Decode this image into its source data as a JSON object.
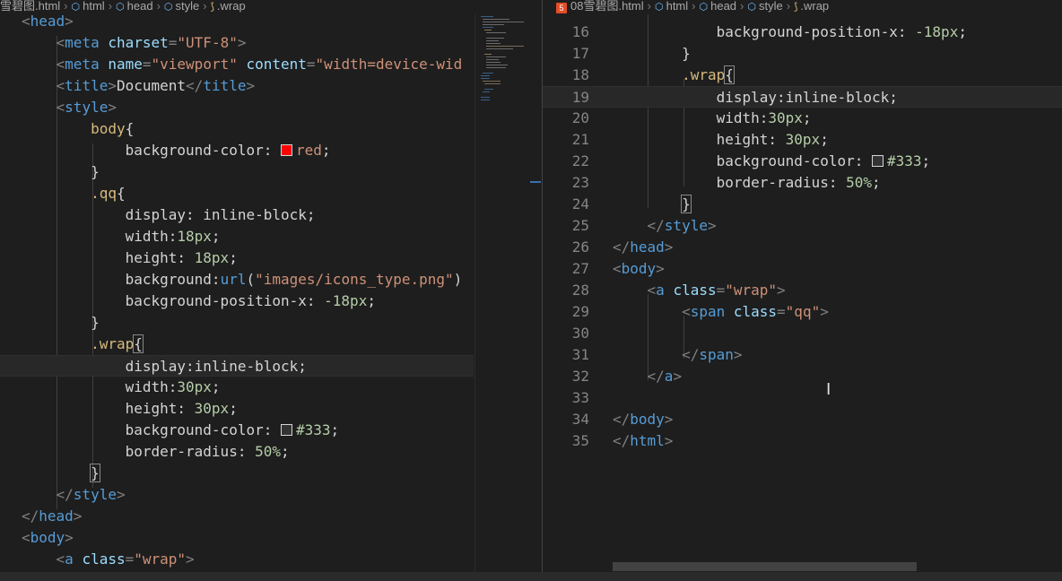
{
  "left_breadcrumb": {
    "file": "雪碧图.html",
    "path": [
      "html",
      "head",
      "style",
      ".wrap"
    ]
  },
  "right_breadcrumb": {
    "file": "08雪碧图.html",
    "path": [
      "html",
      "head",
      "style",
      ".wrap"
    ]
  },
  "left_editor": {
    "lines": [
      [
        [
          "t-punc",
          "<"
        ],
        [
          "t-tag",
          "head"
        ],
        [
          "t-punc",
          ">"
        ]
      ],
      [
        [
          "",
          "    "
        ],
        [
          "t-punc",
          "<"
        ],
        [
          "t-tag",
          "meta"
        ],
        [
          "t-attr",
          " charset"
        ],
        [
          "t-punc",
          "="
        ],
        [
          "t-str",
          "\"UTF-8\""
        ],
        [
          "t-punc",
          ">"
        ]
      ],
      [
        [
          "",
          "    "
        ],
        [
          "t-punc",
          "<"
        ],
        [
          "t-tag",
          "meta"
        ],
        [
          "t-attr",
          " name"
        ],
        [
          "t-punc",
          "="
        ],
        [
          "t-str",
          "\"viewport\""
        ],
        [
          "t-attr",
          " content"
        ],
        [
          "t-punc",
          "="
        ],
        [
          "t-str",
          "\"width=device-wid"
        ]
      ],
      [
        [
          "",
          "    "
        ],
        [
          "t-punc",
          "<"
        ],
        [
          "t-tag",
          "title"
        ],
        [
          "t-punc",
          ">"
        ],
        [
          "t-prop",
          "Document"
        ],
        [
          "t-punc",
          "</"
        ],
        [
          "t-tag",
          "title"
        ],
        [
          "t-punc",
          ">"
        ]
      ],
      [
        [
          "",
          "    "
        ],
        [
          "t-punc",
          "<"
        ],
        [
          "t-tag",
          "style"
        ],
        [
          "t-punc",
          ">"
        ]
      ],
      [
        [
          "",
          "        "
        ],
        [
          "t-sel",
          "body"
        ],
        [
          "t-prop",
          "{"
        ]
      ],
      [
        [
          "",
          "            "
        ],
        [
          "t-prop",
          "background-color: "
        ],
        [
          "swatch-red",
          ""
        ],
        [
          "t-str",
          "red"
        ],
        [
          "t-prop",
          ";"
        ]
      ],
      [
        [
          "",
          "        "
        ],
        [
          "t-prop",
          "}"
        ]
      ],
      [
        [
          "",
          "        "
        ],
        [
          "t-sel",
          ".qq"
        ],
        [
          "t-prop",
          "{"
        ]
      ],
      [
        [
          "",
          "            "
        ],
        [
          "t-prop",
          "display: inline-block;"
        ]
      ],
      [
        [
          "",
          "            "
        ],
        [
          "t-prop",
          "width:"
        ],
        [
          "t-num",
          "18px"
        ],
        [
          "t-prop",
          ";"
        ]
      ],
      [
        [
          "",
          "            "
        ],
        [
          "t-prop",
          "height: "
        ],
        [
          "t-num",
          "18px"
        ],
        [
          "t-prop",
          ";"
        ]
      ],
      [
        [
          "",
          "            "
        ],
        [
          "t-prop",
          "background:"
        ],
        [
          "t-url",
          "url"
        ],
        [
          "t-prop",
          "("
        ],
        [
          "t-str",
          "\"images/icons_type.png\""
        ],
        [
          "t-prop",
          ")"
        ]
      ],
      [
        [
          "",
          "            "
        ],
        [
          "t-prop",
          "background-position-x: "
        ],
        [
          "t-num",
          "-18px"
        ],
        [
          "t-prop",
          ";"
        ]
      ],
      [
        [
          "",
          "        "
        ],
        [
          "t-prop",
          "}"
        ]
      ],
      [
        [
          "",
          "        "
        ],
        [
          "t-sel",
          ".wrap"
        ],
        [
          "bracket",
          "{"
        ]
      ],
      [
        [
          "",
          "            "
        ],
        [
          "t-prop",
          "display:inline-block;"
        ]
      ],
      [
        [
          "",
          "            "
        ],
        [
          "t-prop",
          "width:"
        ],
        [
          "t-num",
          "30px"
        ],
        [
          "t-prop",
          ";"
        ]
      ],
      [
        [
          "",
          "            "
        ],
        [
          "t-prop",
          "height: "
        ],
        [
          "t-num",
          "30px"
        ],
        [
          "t-prop",
          ";"
        ]
      ],
      [
        [
          "",
          "            "
        ],
        [
          "t-prop",
          "background-color: "
        ],
        [
          "swatch-dark",
          ""
        ],
        [
          "t-num",
          "#333"
        ],
        [
          "t-prop",
          ";"
        ]
      ],
      [
        [
          "",
          "            "
        ],
        [
          "t-prop",
          "border-radius: "
        ],
        [
          "t-num",
          "50%"
        ],
        [
          "t-prop",
          ";"
        ]
      ],
      [
        [
          "",
          "        "
        ],
        [
          "bracket",
          "}"
        ]
      ],
      [
        [
          "",
          "    "
        ],
        [
          "t-punc",
          "</"
        ],
        [
          "t-tag",
          "style"
        ],
        [
          "t-punc",
          ">"
        ]
      ],
      [
        [
          "t-punc",
          "</"
        ],
        [
          "t-tag",
          "head"
        ],
        [
          "t-punc",
          ">"
        ]
      ],
      [
        [
          "t-punc",
          "<"
        ],
        [
          "t-tag",
          "body"
        ],
        [
          "t-punc",
          ">"
        ]
      ],
      [
        [
          "",
          "    "
        ],
        [
          "t-punc",
          "<"
        ],
        [
          "t-tag",
          "a"
        ],
        [
          "t-attr",
          " class"
        ],
        [
          "t-punc",
          "="
        ],
        [
          "t-str",
          "\"wrap\""
        ],
        [
          "t-punc",
          ">"
        ]
      ]
    ]
  },
  "right_editor": {
    "first_line_number": 16,
    "lines": [
      [
        [
          "",
          "            "
        ],
        [
          "t-prop",
          "background-position-x: "
        ],
        [
          "t-num",
          "-18px"
        ],
        [
          "t-prop",
          ";"
        ]
      ],
      [
        [
          "",
          "        "
        ],
        [
          "t-prop",
          "}"
        ]
      ],
      [
        [
          "",
          "        "
        ],
        [
          "t-sel",
          ".wrap"
        ],
        [
          "bracket",
          "{"
        ]
      ],
      [
        [
          "",
          "            "
        ],
        [
          "t-prop",
          "display:inline-block;"
        ]
      ],
      [
        [
          "",
          "            "
        ],
        [
          "t-prop",
          "width:"
        ],
        [
          "t-num",
          "30px"
        ],
        [
          "t-prop",
          ";"
        ]
      ],
      [
        [
          "",
          "            "
        ],
        [
          "t-prop",
          "height: "
        ],
        [
          "t-num",
          "30px"
        ],
        [
          "t-prop",
          ";"
        ]
      ],
      [
        [
          "",
          "            "
        ],
        [
          "t-prop",
          "background-color: "
        ],
        [
          "swatch-dark",
          ""
        ],
        [
          "t-num",
          "#333"
        ],
        [
          "t-prop",
          ";"
        ]
      ],
      [
        [
          "",
          "            "
        ],
        [
          "t-prop",
          "border-radius: "
        ],
        [
          "t-num",
          "50%"
        ],
        [
          "t-prop",
          ";"
        ]
      ],
      [
        [
          "",
          "        "
        ],
        [
          "bracket",
          "}"
        ]
      ],
      [
        [
          "",
          "    "
        ],
        [
          "t-punc",
          "</"
        ],
        [
          "t-tag",
          "style"
        ],
        [
          "t-punc",
          ">"
        ]
      ],
      [
        [
          "t-punc",
          "</"
        ],
        [
          "t-tag",
          "head"
        ],
        [
          "t-punc",
          ">"
        ]
      ],
      [
        [
          "t-punc",
          "<"
        ],
        [
          "t-tag",
          "body"
        ],
        [
          "t-punc",
          ">"
        ]
      ],
      [
        [
          "",
          "    "
        ],
        [
          "t-punc",
          "<"
        ],
        [
          "t-tag",
          "a"
        ],
        [
          "t-attr",
          " class"
        ],
        [
          "t-punc",
          "="
        ],
        [
          "t-str",
          "\"wrap\""
        ],
        [
          "t-punc",
          ">"
        ]
      ],
      [
        [
          "",
          "        "
        ],
        [
          "t-punc",
          "<"
        ],
        [
          "t-tag",
          "span"
        ],
        [
          "t-attr",
          " class"
        ],
        [
          "t-punc",
          "="
        ],
        [
          "t-str",
          "\"qq\""
        ],
        [
          "t-punc",
          ">"
        ]
      ],
      [],
      [
        [
          "",
          "        "
        ],
        [
          "t-punc",
          "</"
        ],
        [
          "t-tag",
          "span"
        ],
        [
          "t-punc",
          ">"
        ]
      ],
      [
        [
          "",
          "    "
        ],
        [
          "t-punc",
          "</"
        ],
        [
          "t-tag",
          "a"
        ],
        [
          "t-punc",
          ">"
        ]
      ],
      [],
      [
        [
          "t-punc",
          "</"
        ],
        [
          "t-tag",
          "body"
        ],
        [
          "t-punc",
          ">"
        ]
      ],
      [
        [
          "t-punc",
          "</"
        ],
        [
          "t-tag",
          "html"
        ],
        [
          "t-punc",
          ">"
        ]
      ]
    ]
  },
  "colors": {
    "editor_bg": "#1e1e1e",
    "tag": "#569cd6",
    "attribute": "#9cdcfe",
    "string": "#ce9178",
    "selector": "#d7ba7d",
    "number": "#b5cea8",
    "swatch_red": "#ff0000",
    "swatch_dark": "#333333"
  },
  "icons": {
    "breadcrumb_element": "cube-icon",
    "breadcrumb_selector": "selector-icon",
    "file_type": "html5-icon"
  }
}
